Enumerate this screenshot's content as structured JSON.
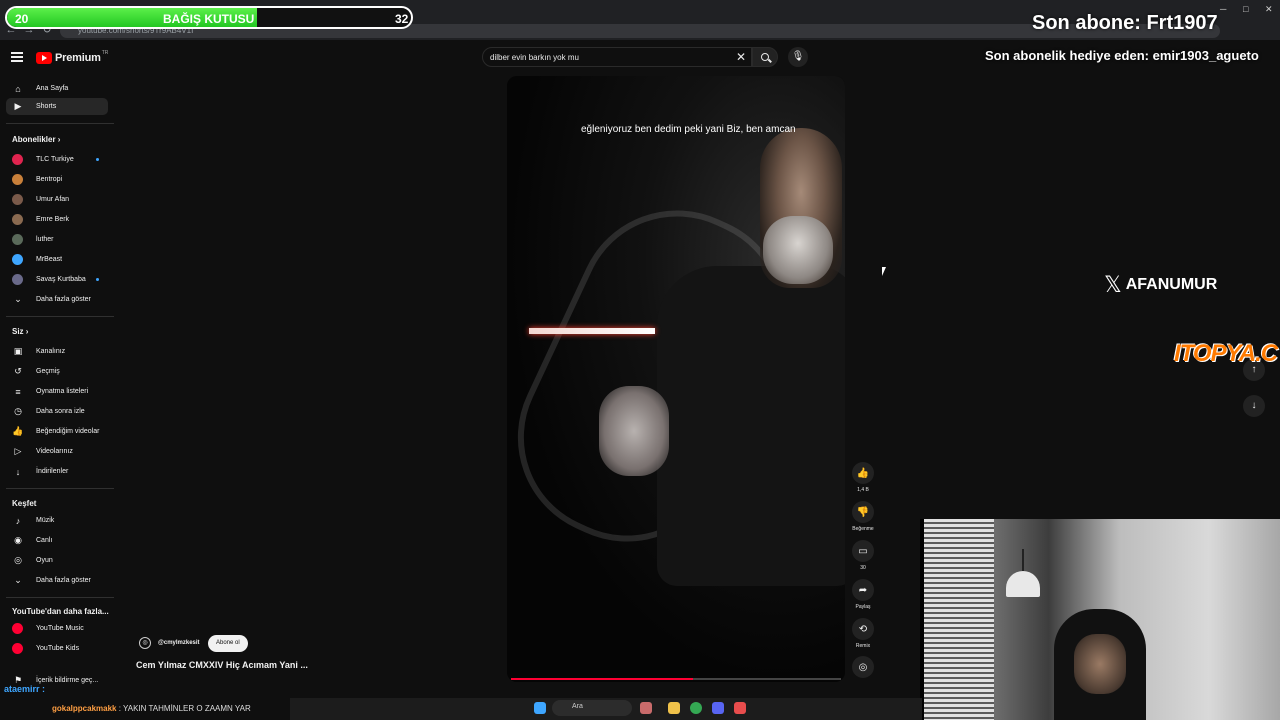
{
  "browser": {
    "url": "youtube.com/shorts/9Tr9AB4V1I"
  },
  "header": {
    "logo_text": "Premium",
    "logo_badge": "TR",
    "search_query": "dilber evin barkın yok mu"
  },
  "sidebar": {
    "nav": [
      {
        "label": "Ana Sayfa",
        "icon": "home-icon"
      },
      {
        "label": "Shorts",
        "icon": "shorts-icon",
        "active": true
      }
    ],
    "subscriptions_heading": "Abonelikler",
    "subscriptions": [
      {
        "label": "TLC Turkiye",
        "color": "#e0244f",
        "new": true
      },
      {
        "label": "Bentropi",
        "color": "#c9803a",
        "new": false
      },
      {
        "label": "Umur Afan",
        "color": "#7a5a4a",
        "new": false
      },
      {
        "label": "Emre Berk",
        "color": "#8a6a50",
        "new": false
      },
      {
        "label": "luther",
        "color": "#5a6a5a",
        "new": false
      },
      {
        "label": "MrBeast",
        "color": "#3ea6ff",
        "new": false
      },
      {
        "label": "Savaş Kurtbaba",
        "color": "#6a6a8a",
        "new": true
      }
    ],
    "show_more_1": "Daha fazla göster",
    "you_heading": "Siz",
    "you_items": [
      {
        "label": "Kanalınız",
        "icon": "channel-icon"
      },
      {
        "label": "Geçmiş",
        "icon": "history-icon"
      },
      {
        "label": "Oynatma listeleri",
        "icon": "playlist-icon"
      },
      {
        "label": "Daha sonra izle",
        "icon": "clock-icon"
      },
      {
        "label": "Beğendiğim videolar",
        "icon": "like-icon"
      },
      {
        "label": "Videolarınız",
        "icon": "video-icon"
      },
      {
        "label": "İndirilenler",
        "icon": "download-icon"
      }
    ],
    "explore_heading": "Keşfet",
    "explore_items": [
      {
        "label": "Müzik",
        "icon": "music-icon"
      },
      {
        "label": "Canlı",
        "icon": "live-icon"
      },
      {
        "label": "Oyun",
        "icon": "gaming-icon"
      }
    ],
    "show_more_2": "Daha fazla göster",
    "more_heading": "YouTube'dan daha fazla...",
    "more_items": [
      {
        "label": "YouTube Music",
        "color": "#ff0033"
      },
      {
        "label": "YouTube Kids",
        "color": "#ff0033"
      }
    ],
    "report_item": "İçerik bildirme geç..."
  },
  "video": {
    "caption": "eğleniyoruz ben dedim peki yani Biz, ben amcan",
    "channel": "@cmylmzkesit",
    "subscribe_label": "Abone ol",
    "title": "Cem Yılmaz CMXXIV Hiç Acımam Yani ...",
    "progress": 0.55
  },
  "actions": {
    "like_count": "1,4 B",
    "dislike_label": "Beğenme",
    "comment_count": "30",
    "share_label": "Paylaş",
    "remix_label": "Remix"
  },
  "overlay": {
    "donation_left": "20",
    "donation_title": "BAĞIŞ KUTUSU",
    "donation_right": "32",
    "donation_progress": 0.62,
    "last_sub": "Son abone: Frt1907",
    "last_gift": "Son abonelik hediye eden: emir1903_agueto",
    "x_handle": "AFANUMUR",
    "sponsor": "ITOPYA.C"
  },
  "chat": {
    "user1": "ataemirr :",
    "user2": "gokalppcakmakk",
    "message2": ": YAKIN TAHMİNLER O ZAAMN YAR"
  },
  "taskbar": {
    "search_label": "Ara"
  }
}
